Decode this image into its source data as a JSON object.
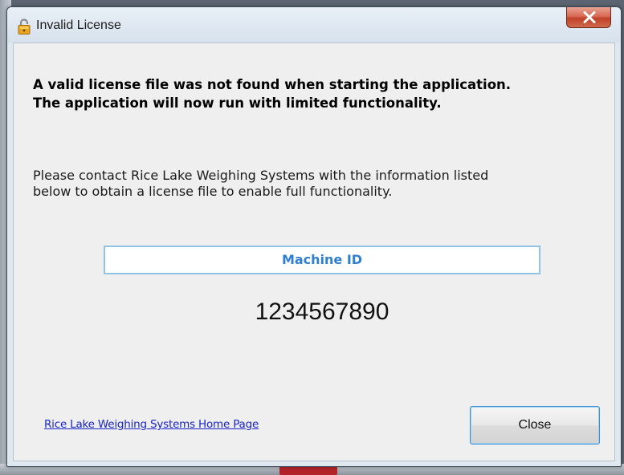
{
  "window": {
    "title": "Invalid License",
    "title_icon": "padlock-icon",
    "close_icon": "close-x-icon"
  },
  "message": {
    "heading_lines": [
      "A valid license file was not found when starting the application.",
      "The application will now run with limited functionality."
    ],
    "body_lines": [
      "Please contact Rice Lake Weighing Systems with the information listed",
      "below to obtain a license file to enable full functionality."
    ]
  },
  "machine": {
    "label": "Machine ID",
    "id": "1234567890"
  },
  "footer": {
    "link_text": "Rice Lake Weighing Systems Home Page",
    "close_label": "Close"
  },
  "colors": {
    "link": "#1a24c8",
    "label_text": "#2f7fcf",
    "label_border": "#8fc3e6"
  }
}
